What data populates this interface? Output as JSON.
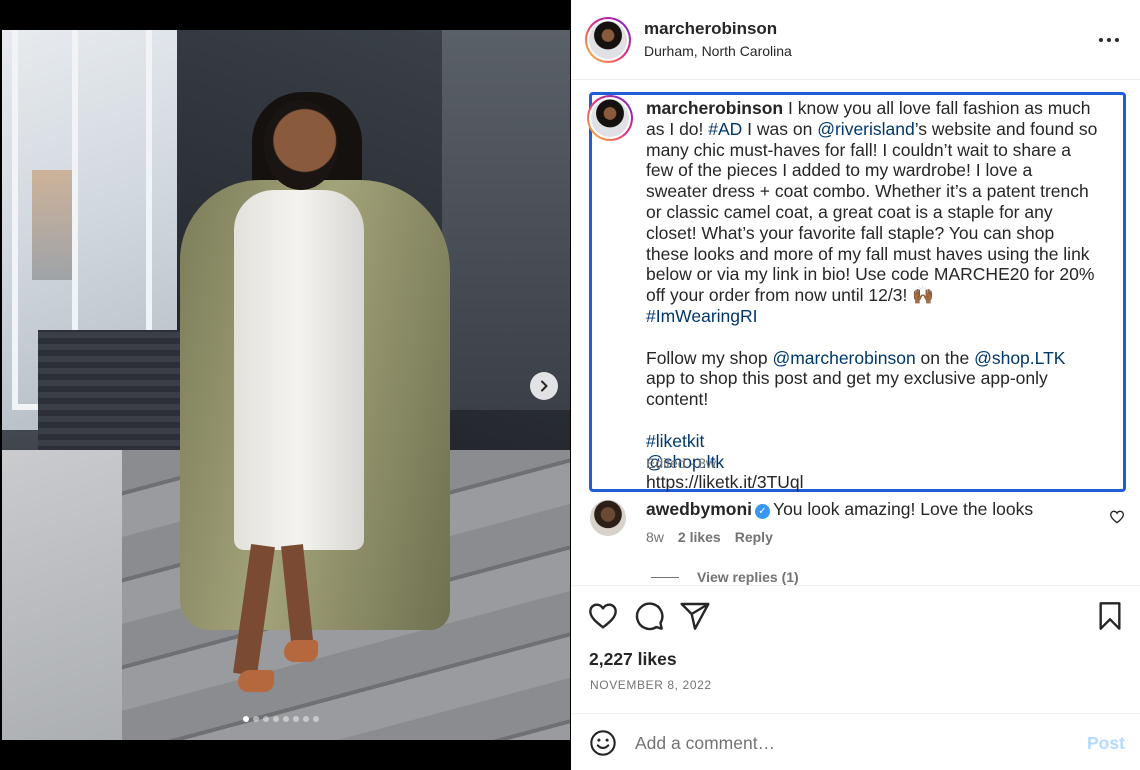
{
  "media": {
    "image_count": 8,
    "active_index": 0
  },
  "header": {
    "username": "marcherobinson",
    "location": "Durham, North Carolina"
  },
  "caption": {
    "username": "marcherobinson",
    "text_1": " I know you all love fall fashion as much as I do! ",
    "tag_ad": "#AD",
    "text_2": " I was on ",
    "mention_riverisland": "@riverisland",
    "text_3": "’s website and found so many chic must-haves for fall! I couldn’t wait to share a few of the pieces I added to my wardrobe! I love a sweater dress + coat combo. Whether it’s a patent trench or classic camel coat, a great coat is a staple for any closet! What’s your favorite fall staple? You can shop these looks and more of my fall must haves using the link below or via my link in bio! Use code MARCHE20 for 20% off your order from now until 12/3! 🙌🏾\n",
    "tag_imwearingri": "#ImWearingRI",
    "text_4": "\n\nFollow my shop ",
    "mention_marcherobinson": "@marcherobinson",
    "text_5": " on the ",
    "mention_shopltk": "@shop.LTK",
    "text_6": " app to shop this post and get my exclusive app-only content!\n\n",
    "tag_liketkit": "#liketkit",
    "newline": "\n",
    "mention_shopltk2": "@shop.ltk",
    "url_line": "\nhttps://liketk.it/3TUql",
    "edited": "Edited · 8w"
  },
  "comment": {
    "username": "awedbymoni",
    "verified_glyph": "✓",
    "text": "You look amazing! Love the looks",
    "age": "8w",
    "likes": "2 likes",
    "reply": "Reply",
    "view_replies": "View replies (1)"
  },
  "actions": {
    "likes": "2,227 likes",
    "date": "NOVEMBER 8, 2022"
  },
  "add_comment": {
    "placeholder": "Add a comment…",
    "post_label": "Post"
  },
  "colors": {
    "accent": "#0095f6",
    "post_disabled": "#b3dbff",
    "link": "#00376b",
    "highlight_border": "#1f5ed8"
  },
  "icons": {
    "next": "chevron-right-icon",
    "more": "more-horizontal-icon",
    "like": "heart-icon",
    "comment": "comment-bubble-icon",
    "share": "paper-plane-icon",
    "save": "bookmark-icon",
    "emoji": "smiley-icon"
  }
}
